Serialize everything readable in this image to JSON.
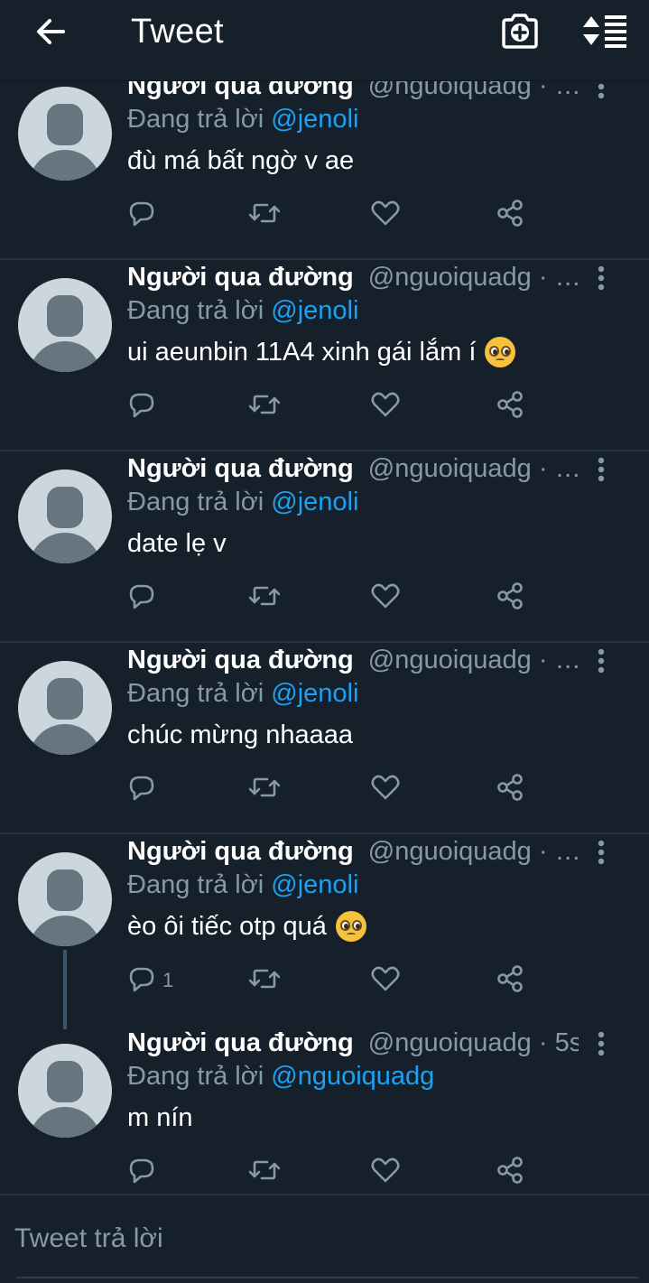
{
  "header": {
    "title": "Tweet",
    "back_icon": "arrow-left-icon",
    "camera_icon": "camera-plus-icon",
    "sort_icon": "sort-icon"
  },
  "colors": {
    "background": "#15202b",
    "accent": "#1da1f2",
    "muted": "#8899a6",
    "divider": "#25323f"
  },
  "tweets": [
    {
      "name": "Người qua đường",
      "handle": "@nguoiquadg · …",
      "reply_prefix": "Đang trả lời ",
      "reply_to": "@jenoli",
      "text": "đù má bất ngờ v ae",
      "emoji": "",
      "reply_count": ""
    },
    {
      "name": "Người qua đường",
      "handle": "@nguoiquadg · …",
      "reply_prefix": "Đang trả lời ",
      "reply_to": "@jenoli",
      "text": "ui aeunbin 11A4 xinh gái lắm í",
      "emoji": "pleading-face",
      "reply_count": ""
    },
    {
      "name": "Người qua đường",
      "handle": "@nguoiquadg · …",
      "reply_prefix": "Đang trả lời ",
      "reply_to": "@jenoli",
      "text": "date lẹ v",
      "emoji": "",
      "reply_count": ""
    },
    {
      "name": "Người qua đường",
      "handle": "@nguoiquadg · …",
      "reply_prefix": "Đang trả lời ",
      "reply_to": "@jenoli",
      "text": "chúc mừng nhaaaa",
      "emoji": "",
      "reply_count": ""
    },
    {
      "name": "Người qua đường",
      "handle": "@nguoiquadg · …",
      "reply_prefix": "Đang trả lời ",
      "reply_to": "@jenoli",
      "text": "èo ôi tiếc otp quá",
      "emoji": "pleading-face",
      "reply_count": "1"
    },
    {
      "name": "Người qua đường",
      "handle": "@nguoiquadg · 5s",
      "reply_prefix": "Đang trả lời ",
      "reply_to": "@nguoiquadg",
      "text": "m nín",
      "emoji": "",
      "reply_count": ""
    }
  ],
  "compose": {
    "placeholder": "Tweet trả lời"
  }
}
